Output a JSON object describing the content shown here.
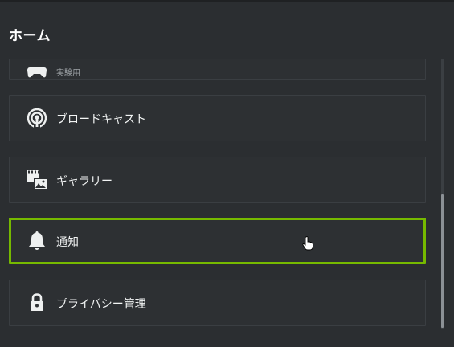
{
  "header": {
    "title": "ホーム"
  },
  "menu": {
    "items": [
      {
        "label": "",
        "sublabel": "実験用",
        "icon": "gamepad-icon"
      },
      {
        "label": "ブロードキャスト",
        "icon": "broadcast-icon"
      },
      {
        "label": "ギャラリー",
        "icon": "gallery-icon"
      },
      {
        "label": "通知",
        "icon": "bell-icon",
        "selected": true
      },
      {
        "label": "プライバシー管理",
        "icon": "lock-icon"
      }
    ]
  },
  "colors": {
    "background": "#2b2e31",
    "card": "#2d3033",
    "accent": "#76b900",
    "text": "#f2f4f4"
  }
}
